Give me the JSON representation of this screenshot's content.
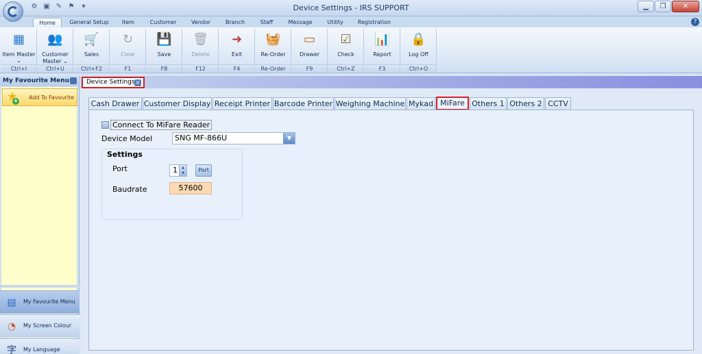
{
  "window": {
    "title": "Device Settings - IRS SUPPORT",
    "controls": [
      "minimize",
      "restore",
      "close"
    ]
  },
  "ribbon_tabs": [
    "Home",
    "General Setup",
    "Item",
    "Customer",
    "Vendor",
    "Branch",
    "Staff",
    "Message",
    "Utility",
    "Registration"
  ],
  "ribbon_active_tab": "Home",
  "ribbon_buttons": [
    {
      "label": "Item Master",
      "sub": "⌄",
      "key": "Ctrl+I",
      "icon": "item-master-icon"
    },
    {
      "label": "Customer Master ⌄",
      "key": "Ctrl+U",
      "icon": "customer-master-icon"
    },
    {
      "label": "Sales",
      "key": "Ctrl+F2",
      "icon": "sales-icon"
    },
    {
      "label": "Clear",
      "key": "F1",
      "icon": "clear-icon",
      "disabled": true
    },
    {
      "label": "Save",
      "key": "F8",
      "icon": "save-icon"
    },
    {
      "label": "Delete",
      "key": "F12",
      "icon": "delete-icon",
      "disabled": true
    },
    {
      "label": "Exit",
      "key": "F4",
      "icon": "exit-icon"
    },
    {
      "label": "Re-Order",
      "key": "Re-Order",
      "icon": "reorder-basket-icon"
    },
    {
      "label": "Drawer",
      "key": "F9",
      "icon": "drawer-icon"
    },
    {
      "label": "Check",
      "key": "Ctrl+Z",
      "icon": "check-list-icon"
    },
    {
      "label": "Report",
      "key": "F3",
      "icon": "report-chart-icon"
    },
    {
      "label": "Log Off",
      "key": "Ctrl+O",
      "icon": "lock-icon"
    }
  ],
  "left_panel": {
    "title": "My Favourite Menu",
    "add_favourite": "Add To Favourite",
    "nav": [
      {
        "label": "My Favourite Menu",
        "active": true,
        "icon": "favourite-menu-icon"
      },
      {
        "label": "My Screen Colour",
        "active": false,
        "icon": "screen-colour-icon"
      },
      {
        "label": "My Language",
        "active": false,
        "icon": "language-icon"
      }
    ]
  },
  "document_tab": "Device Settings",
  "device_tabs": [
    "Cash Drawer",
    "Customer Display",
    "Receipt Printer",
    "Barcode Printer",
    "Weighing Machine",
    "Mykad",
    "MiFare",
    "Others 1",
    "Others 2",
    "CCTV"
  ],
  "active_device_tab": "MiFare",
  "mifare": {
    "connect_label": "Connect To MiFare Reader",
    "connect_checked": false,
    "device_model_label": "Device Model",
    "device_model_value": "SNG MF-866U",
    "settings_title": "Settings",
    "port_label": "Port",
    "port_value": "1",
    "port_button": "Port",
    "baudrate_label": "Baudrate",
    "baudrate_value": "57600"
  },
  "colors": {
    "highlight_border": "#d21f2a",
    "baud_field_bg": "#ffd9b3",
    "favourite_area_bg": "#ffffcc"
  }
}
